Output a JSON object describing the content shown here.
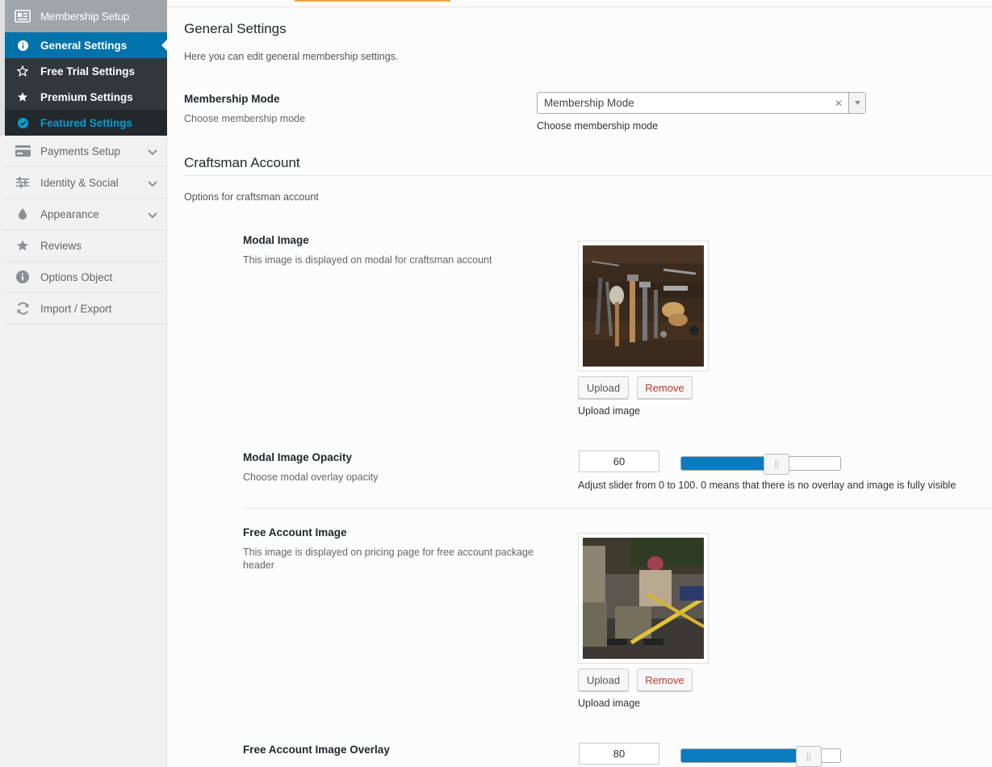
{
  "sidebar": {
    "header": {
      "label": "Membership Setup",
      "icon": "id-card-icon"
    },
    "subitems": [
      {
        "label": "General Settings",
        "icon": "info-circle-icon",
        "state": "active"
      },
      {
        "label": "Free Trial Settings",
        "icon": "star-outline-icon",
        "state": "normal"
      },
      {
        "label": "Premium Settings",
        "icon": "star-icon",
        "state": "normal"
      },
      {
        "label": "Featured Settings",
        "icon": "check-circle-icon",
        "state": "featured"
      }
    ],
    "items": [
      {
        "label": "Payments Setup",
        "icon": "credit-card-icon",
        "has_submenu": true
      },
      {
        "label": "Identity & Social",
        "icon": "sliders-icon",
        "has_submenu": true
      },
      {
        "label": "Appearance",
        "icon": "drop-icon",
        "has_submenu": true
      },
      {
        "label": "Reviews",
        "icon": "star-icon",
        "has_submenu": false
      },
      {
        "label": "Options Object",
        "icon": "info-circle-icon",
        "has_submenu": false
      },
      {
        "label": "Import / Export",
        "icon": "refresh-icon",
        "has_submenu": false
      }
    ]
  },
  "general": {
    "title": "General Settings",
    "description": "Here you can edit general membership settings.",
    "membership_mode": {
      "label": "Membership Mode",
      "sublabel": "Choose membership mode",
      "value": "Membership Mode",
      "help": "Choose membership mode"
    }
  },
  "craftsman": {
    "title": "Craftsman Account",
    "description": "Options for craftsman account",
    "modal_image": {
      "label": "Modal Image",
      "sublabel": "This image is displayed on modal for craftsman account",
      "upload_label": "Upload",
      "remove_label": "Remove",
      "help": "Upload image"
    },
    "modal_opacity": {
      "label": "Modal Image Opacity",
      "sublabel": "Choose modal overlay opacity",
      "value": "60",
      "slider_value": 60,
      "help": "Adjust slider from 0 to 100. 0 means that there is no overlay and image is fully visible"
    },
    "free_image": {
      "label": "Free Account Image",
      "sublabel": "This image is displayed on pricing page for free account package header",
      "upload_label": "Upload",
      "remove_label": "Remove",
      "help": "Upload image"
    },
    "free_overlay": {
      "label": "Free Account Image Overlay",
      "value": "80",
      "slider_value": 80
    }
  },
  "colors": {
    "accent": "#0073aa",
    "sidebar_dark": "#32373c",
    "featured_text": "#00a0d2",
    "slider_fill": "#0c7bbf",
    "remove_text": "#c0392b"
  }
}
